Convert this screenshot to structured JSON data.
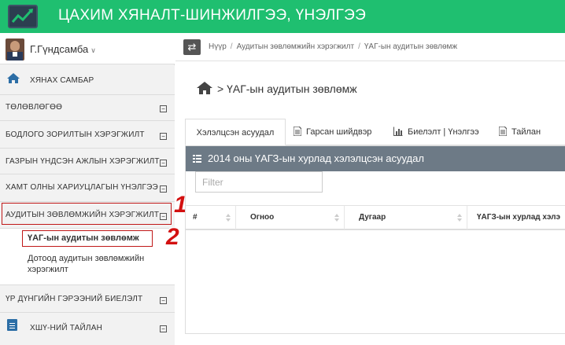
{
  "app": {
    "title": "ЦАХИМ ХЯНАЛТ-ШИНЖИЛГЭЭ, ҮНЭЛГЭЭ"
  },
  "user": {
    "name": "Г.Гүндсамба"
  },
  "sidebar": {
    "items": [
      {
        "label": "ХЯНАХ САМБАР"
      },
      {
        "label": "ТӨЛӨВЛӨГӨӨ",
        "toggle": "−"
      },
      {
        "label": "БОДЛОГО ЗОРИЛТЫН ХЭРЭГЖИЛТ",
        "toggle": "−"
      },
      {
        "label": "ГАЗРЫН ҮНДСЭН АЖЛЫН ХЭРЭГЖИЛТ",
        "toggle": "−"
      },
      {
        "label": "ХАМТ ОЛНЫ ХАРИУЦЛАГЫН ҮНЭЛГЭЭ",
        "toggle": "−"
      },
      {
        "label": "АУДИТЫН ЗӨВЛӨМЖИЙН ХЭРЭГЖИЛТ",
        "toggle": "−"
      },
      {
        "label": "ҮР ДҮНГИЙН ГЭРЭЭНИЙ БИЕЛЭЛТ",
        "toggle": "−"
      },
      {
        "label": "ХШҮ-НИЙ ТАЙЛАН",
        "toggle": "−"
      }
    ],
    "subitems": [
      {
        "label": "ҮАГ-ын аудитын зөвлөмж"
      },
      {
        "label": "Дотоод аудитын зөвлөмжийн хэрэгжилт"
      }
    ]
  },
  "markers": {
    "one": "1",
    "two": "2"
  },
  "breadcrumb": {
    "items": [
      "Нүүр",
      "Аудитын зөвлөмжийн хэрэгжилт",
      "ҮАГ-ын аудитын зөвлөмж"
    ],
    "separator": "/"
  },
  "page": {
    "heading": "> ҮАГ-ын аудитын зөвлөмж"
  },
  "tabs": [
    {
      "label": "Хэлэлцсэн асуудал"
    },
    {
      "label": "Гарсан шийдвэр"
    },
    {
      "label": "Биелэлт | Үнэлгээ"
    },
    {
      "label": "Тайлан"
    }
  ],
  "panel": {
    "title": "2014 оны ҮАГЗ-ын хурлад хэлэлцсэн асуудал",
    "filter_placeholder": "Filter",
    "columns": [
      "#",
      "Огноо",
      "Дугаар",
      "ҮАГЗ-ын хурлад хэлэ"
    ]
  },
  "colors": {
    "header_green": "#1fbf70",
    "panel_head": "#6d7a86",
    "marker_red": "#d31010",
    "sidebar_bg": "#f2f2f2"
  }
}
